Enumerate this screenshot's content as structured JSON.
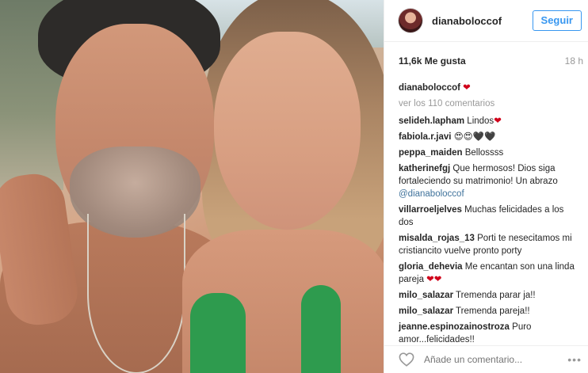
{
  "header": {
    "username": "dianaboloccof",
    "follow_label": "Seguir"
  },
  "meta": {
    "likes": "11,6k Me gusta",
    "age": "18 h"
  },
  "caption": {
    "user": "dianaboloccof",
    "emoji": "❤"
  },
  "view_all": "ver los 110 comentarios",
  "comments": [
    {
      "user": "selideh.lapham",
      "text": "Lindos",
      "emoji": "❤"
    },
    {
      "user": "fabiola.r.javi",
      "text": "",
      "emoji": "😍😍🖤🖤"
    },
    {
      "user": "peppa_maiden",
      "text": "Bellossss",
      "emoji": ""
    },
    {
      "user": "katherinefgj",
      "text": "Que hermosos! Dios siga fortaleciendo su matrimonio! Un abrazo",
      "mention": "@dianaboloccof",
      "emoji": ""
    },
    {
      "user": "villarroeljelves",
      "text": "Muchas felicidades a los dos",
      "emoji": ""
    },
    {
      "user": "misalda_rojas_13",
      "text": "Porti te nesecitamos mi cristiancito vuelve pronto porty",
      "emoji": ""
    },
    {
      "user": "gloria_dehevia",
      "text": "Me encantan son una linda pareja",
      "emoji": "❤❤"
    },
    {
      "user": "milo_salazar",
      "text": "Tremenda parar ja!!",
      "emoji": ""
    },
    {
      "user": "milo_salazar",
      "text": "Tremenda pareja!!",
      "emoji": ""
    },
    {
      "user": "jeanne.espinozainostroza",
      "text": "Puro amor...felicidades!!",
      "emoji": ""
    }
  ],
  "footer": {
    "comment_placeholder": "Añade un comentario...",
    "more": "•••"
  },
  "colors": {
    "follow_blue": "#3897f0",
    "heart_red": "#d0021b",
    "text": "#262626",
    "muted": "#999999"
  },
  "icons": {
    "like": "heart-outline-icon",
    "more": "more-options-icon"
  }
}
